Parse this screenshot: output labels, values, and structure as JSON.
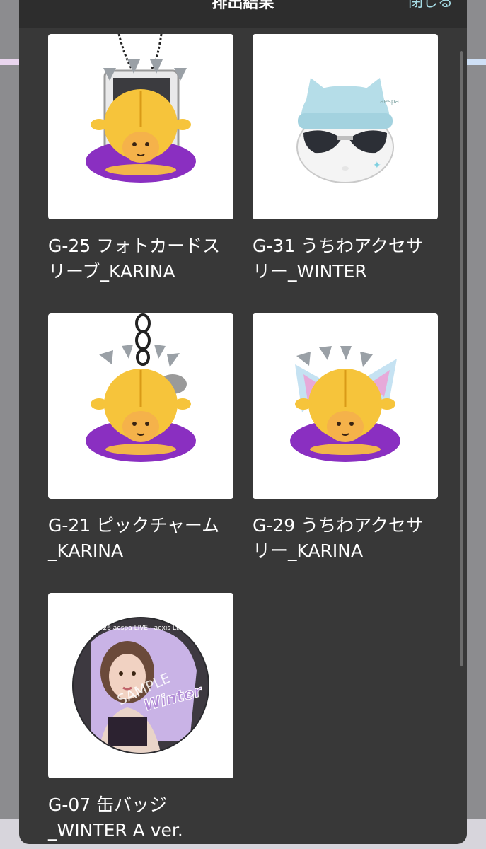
{
  "modal": {
    "title": "排出結果",
    "close_label": "閉じる"
  },
  "items": [
    {
      "code": "G-25",
      "caption": "G-25 フォトカードス\nリーブ_KARINA",
      "icon": "bowing-woman-photocard-sleeve"
    },
    {
      "code": "G-31",
      "caption": "G-31 うちわアクセサ\nリー_WINTER",
      "icon": "cat-beanie-sunglasses-accessory"
    },
    {
      "code": "G-21",
      "caption": "G-21 ピックチャーム\n_KARINA",
      "icon": "bowing-woman-pick-charm"
    },
    {
      "code": "G-29",
      "caption": "G-29 うちわアクセサ\nリー_KARINA",
      "icon": "bowing-woman-uchiwa-accessory"
    },
    {
      "code": "G-07",
      "caption": "G-07 缶バッジ\n_WINTER A ver.",
      "icon": "can-badge-winter"
    }
  ],
  "badge": {
    "name_text": "Winter",
    "sample_text": "SAMPLE",
    "ring_text": "2026 aespa LIVE · aexis LINE"
  },
  "colors": {
    "modal_bg": "#383838",
    "header_bg": "#2d2d2d",
    "close_link": "#a7dde6",
    "caption_text": "#ffffff"
  }
}
